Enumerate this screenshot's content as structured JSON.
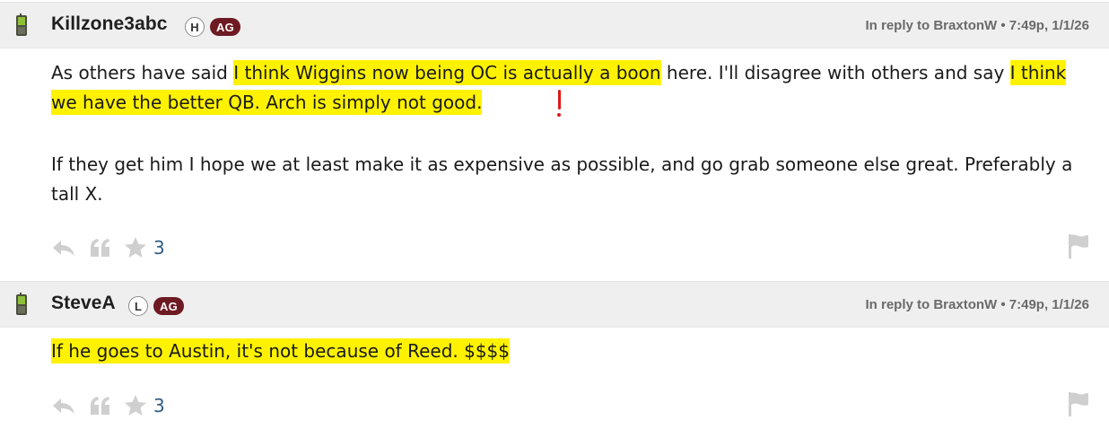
{
  "posts": [
    {
      "username": "Killzone3abc",
      "badge_letter": "H",
      "badge_group": "AG",
      "reply_meta": "In reply to BraxtonW • 7:49p, 1/1/26",
      "para1": {
        "plain_a": "As others have said ",
        "hl_a": "I think Wiggins now being OC is actually a boon",
        "plain_b": " here. I'll disagree with others and say ",
        "hl_b": "I think we have the better QB. Arch is simply not good."
      },
      "para2": "If they get him I hope we at least make it as expensive as possible, and go grab someone else great. Preferably a tall X.",
      "star_count": "3",
      "icons": [
        "device-icon",
        "reply-icon",
        "quote-icon",
        "star-icon",
        "flag-icon"
      ]
    },
    {
      "username": "SteveA",
      "badge_letter": "L",
      "badge_group": "AG",
      "reply_meta": "In reply to BraxtonW • 7:49p, 1/1/26",
      "para1_hl": "If he goes to Austin, it's not because of Reed. $$$$",
      "star_count": "3",
      "icons": [
        "device-icon",
        "reply-icon",
        "quote-icon",
        "star-icon",
        "flag-icon"
      ]
    }
  ],
  "colors": {
    "header_bg": "#efefef",
    "badge_group_bg": "#6e1a23",
    "highlight": "#fff200",
    "annotation_red": "#e01818",
    "star_count": "#2f5d87",
    "icon_gray": "#cfcfcf"
  }
}
